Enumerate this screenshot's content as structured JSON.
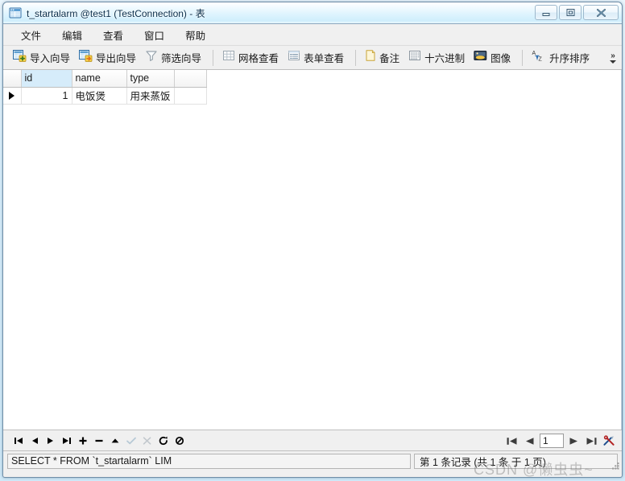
{
  "window": {
    "title": "t_startalarm @test1 (TestConnection) - 表",
    "icon": "table-icon",
    "controls": {
      "minimize": "minimize-icon",
      "maximize": "maximize-icon",
      "close": "close-icon"
    }
  },
  "menubar": {
    "items": [
      {
        "label": "文件",
        "name": "menu-file"
      },
      {
        "label": "编辑",
        "name": "menu-edit"
      },
      {
        "label": "查看",
        "name": "menu-view"
      },
      {
        "label": "窗口",
        "name": "menu-window"
      },
      {
        "label": "帮助",
        "name": "menu-help"
      }
    ]
  },
  "toolbar": {
    "import_wizard": "导入向导",
    "export_wizard": "导出向导",
    "filter_wizard": "筛选向导",
    "grid_view": "网格查看",
    "form_view": "表单查看",
    "memo": "备注",
    "hex": "十六进制",
    "image": "图像",
    "sort_asc": "升序排序",
    "overflow": "»"
  },
  "grid": {
    "columns": [
      "id",
      "name",
      "type"
    ],
    "selected_column": "id",
    "rows": [
      {
        "indicator": "▶",
        "id": "1",
        "name": "电饭煲",
        "type": "用来蒸饭"
      }
    ]
  },
  "navbar": {
    "buttons": [
      {
        "name": "nav-first-record",
        "glyph": "first"
      },
      {
        "name": "nav-prev-record",
        "glyph": "prev"
      },
      {
        "name": "nav-next-record",
        "glyph": "next"
      },
      {
        "name": "nav-last-record",
        "glyph": "last"
      },
      {
        "name": "nav-add-record",
        "glyph": "plus"
      },
      {
        "name": "nav-delete-record",
        "glyph": "minus"
      },
      {
        "name": "nav-edit-record",
        "glyph": "up"
      },
      {
        "name": "nav-apply-changes",
        "glyph": "check"
      },
      {
        "name": "nav-cancel-changes",
        "glyph": "scissors"
      },
      {
        "name": "nav-refresh",
        "glyph": "refresh"
      },
      {
        "name": "nav-stop",
        "glyph": "stop"
      }
    ],
    "page_value": "1",
    "pager": [
      {
        "name": "pager-first-page",
        "glyph": "first"
      },
      {
        "name": "pager-prev-page",
        "glyph": "prev"
      },
      {
        "name": "pager-next-page",
        "glyph": "next"
      },
      {
        "name": "pager-last-page",
        "glyph": "last"
      },
      {
        "name": "pager-tools",
        "glyph": "tools"
      }
    ]
  },
  "statusbar": {
    "sql": "SELECT * FROM `t_startalarm` LIM",
    "record_info": "第 1 条记录 (共 1 条 于 1 页)"
  },
  "watermark": {
    "text": "CSDN @懒虫虫~"
  },
  "colors": {
    "accent": "#cfeefc",
    "window_border": "#6f8ea8",
    "toolbar_bg": "#f0f0f0",
    "selected_header": "#d6ecfa",
    "grid_bg": "#ffffff"
  }
}
